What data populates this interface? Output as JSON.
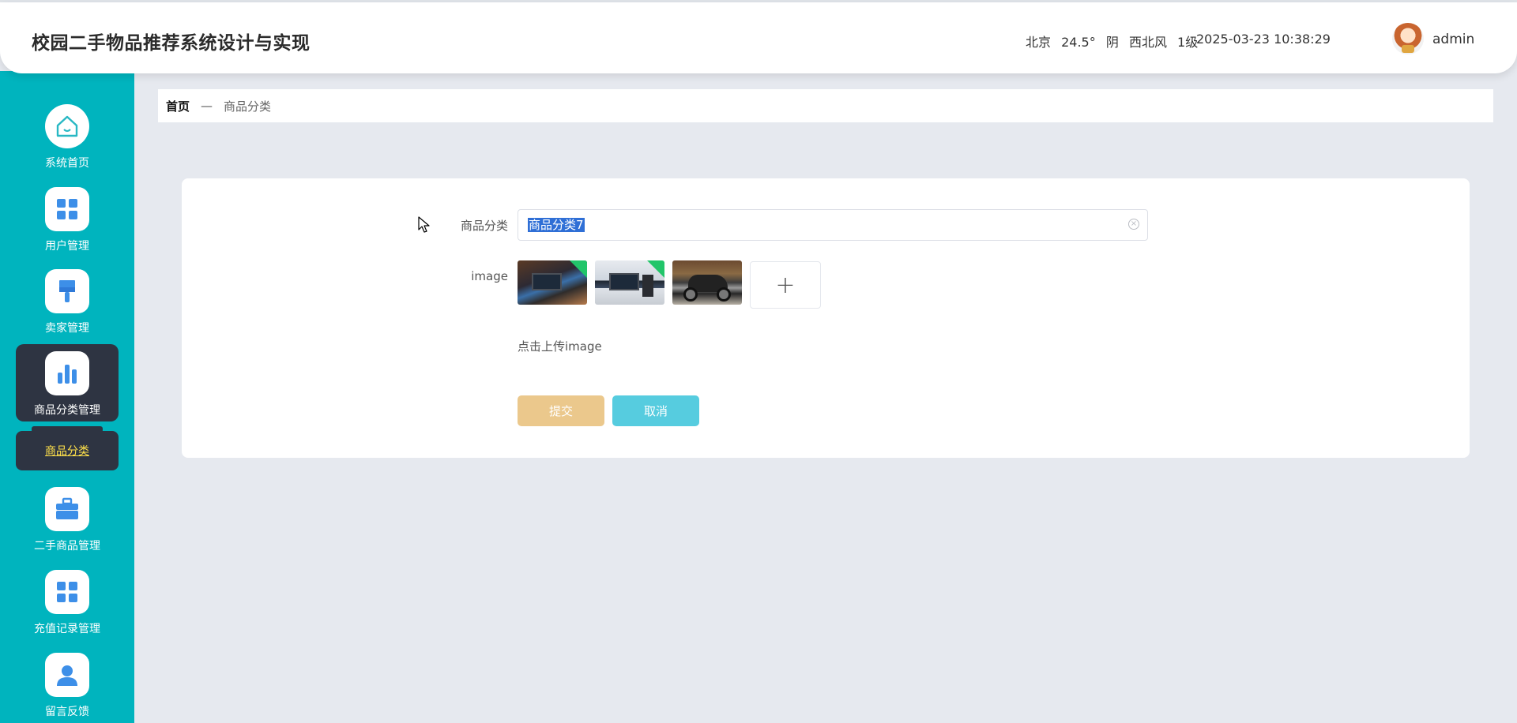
{
  "header": {
    "title": "校园二手物品推荐系统设计与实现",
    "weather": {
      "city": "北京",
      "temperature": "24.5°",
      "condition": "阴",
      "wind": "西北风",
      "wind_level": "1级"
    },
    "datetime": "2025-03-23 10:38:29",
    "username": "admin",
    "avatar_icon": "user-avatar-icon"
  },
  "sidebar": {
    "items": [
      {
        "label": "系统首页",
        "icon": "home-icon"
      },
      {
        "label": "用户管理",
        "icon": "grid-icon"
      },
      {
        "label": "卖家管理",
        "icon": "brush-icon"
      },
      {
        "label": "商品分类管理",
        "icon": "bar-chart-icon",
        "active": true
      },
      {
        "label": "二手商品管理",
        "icon": "briefcase-icon"
      },
      {
        "label": "充值记录管理",
        "icon": "grid-icon"
      },
      {
        "label": "留言反馈",
        "icon": "user-icon"
      }
    ],
    "sub_item": {
      "label": "商品分类"
    }
  },
  "breadcrumb": {
    "home": "首页",
    "separator": "—",
    "current": "商品分类"
  },
  "form": {
    "category_label": "商品分类",
    "category_value": "商品分类7",
    "image_label": "image",
    "images": [
      {
        "icon": "desk-computer-image"
      },
      {
        "icon": "monitor-tower-image"
      },
      {
        "icon": "motorcycle-image"
      }
    ],
    "upload_icon": "plus-icon",
    "upload_hint": "点击上传image",
    "submit_label": "提交",
    "cancel_label": "取消"
  },
  "colors": {
    "sidebar_bg": "#00b4be",
    "active_item_bg": "#2e3442",
    "submit_bg": "#ebc88c",
    "cancel_bg": "#56ccdf",
    "icon_blue": "#3d8fe8",
    "sub_item_text": "#ffe14a"
  }
}
